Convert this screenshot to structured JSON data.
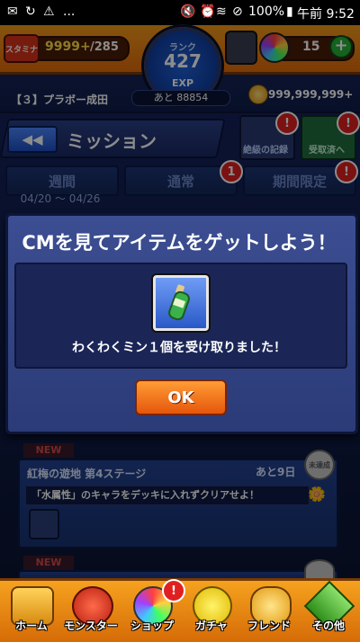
{
  "status_bar": {
    "battery": "100%",
    "time": "午前 9:52",
    "menu": "..."
  },
  "hud": {
    "stamina_label": "スタミナ",
    "stamina_value": "9999+",
    "stamina_max": "/285",
    "rank_label": "ランク",
    "rank_value": "427",
    "exp_label": "EXP",
    "exp_remaining": "あと 88854",
    "player_name": "【３】プラボー成田",
    "gem_count": "15",
    "gold_amount": "999,999,999+"
  },
  "header": {
    "back_label": "◀◀",
    "title": "ミッション",
    "record_button": "絶級の記録",
    "record_badge": "!",
    "claim_button": "受取済へ",
    "claim_badge": "!"
  },
  "tabs": [
    {
      "label": "週間",
      "date_range": "04/20 〜 04/26"
    },
    {
      "label": "通常",
      "badge": "1"
    },
    {
      "label": "期間限定",
      "badge": "!"
    }
  ],
  "modal": {
    "title": "CMを見てアイテムをゲットしよう！",
    "message": "わくわくミン１個を受け取りました！",
    "ok_label": "OK"
  },
  "missions": [
    {
      "new_label": "NEW",
      "title": "紅梅の遊地 第4ステージ",
      "days_left": "あと9日",
      "status_stamp": "未達成",
      "description": "「水属性」のキャラをデッキに入れずクリアせよ！"
    },
    {
      "new_label": "NEW",
      "status_stamp": "未達成"
    }
  ],
  "bottom_nav": [
    {
      "label": "ホーム"
    },
    {
      "label": "モンスター"
    },
    {
      "label": "ショップ",
      "badge": "!"
    },
    {
      "label": "ガチャ"
    },
    {
      "label": "フレンド"
    },
    {
      "label": "その他"
    }
  ],
  "colors": {
    "accent_orange": "#f59a1c",
    "navy": "#1b2a63",
    "ok_button": "#e5560b"
  }
}
